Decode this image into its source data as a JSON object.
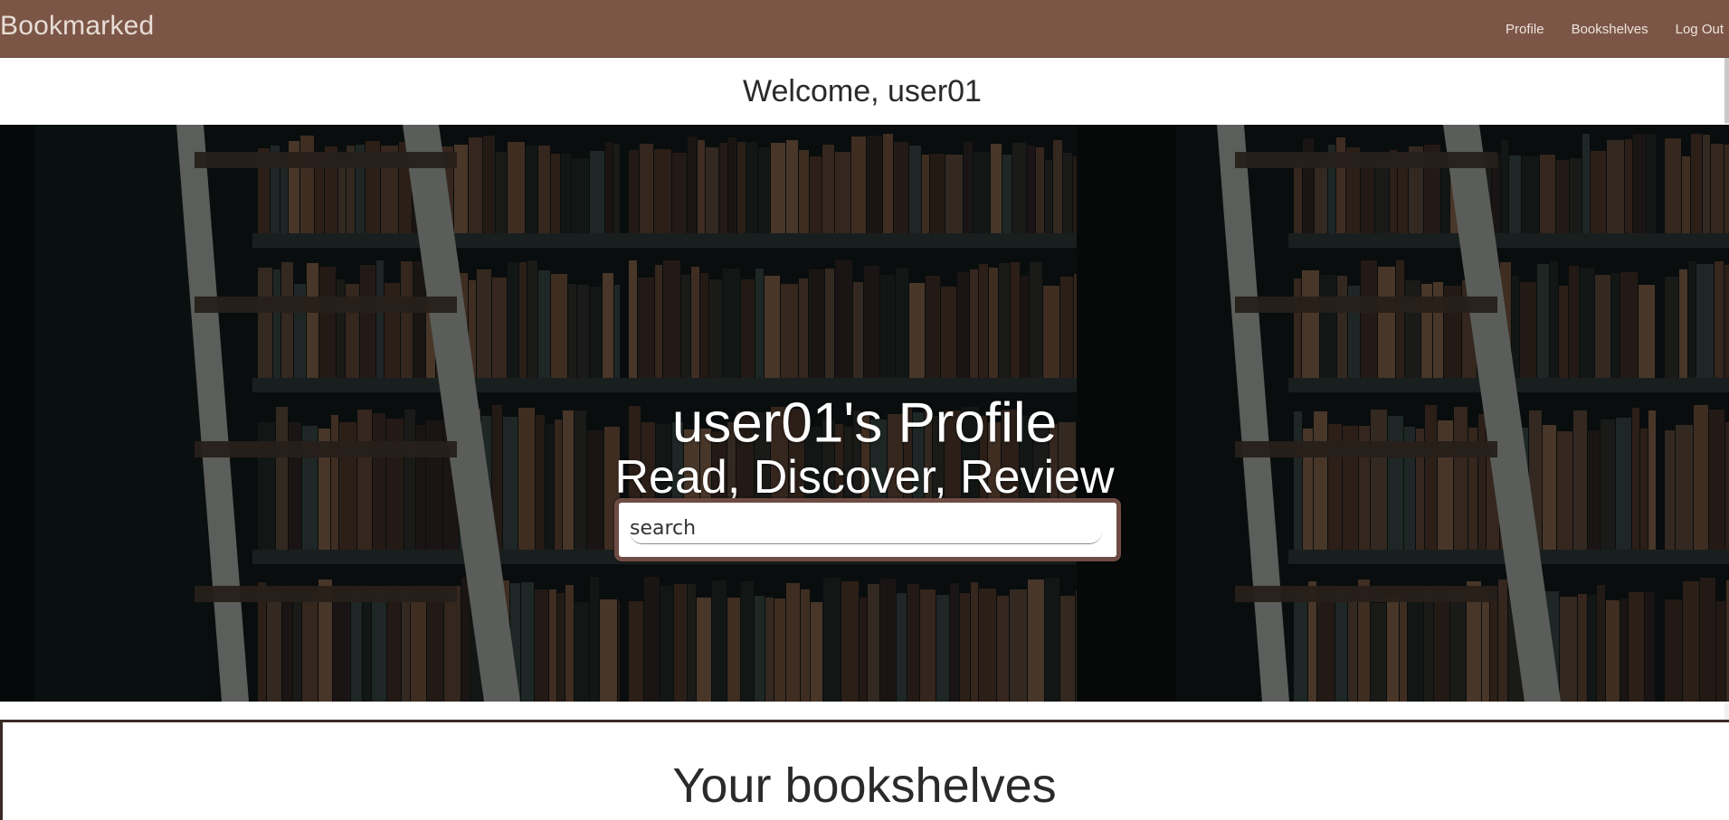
{
  "navbar": {
    "brand": "Bookmarked",
    "links": [
      "Profile",
      "Bookshelves",
      "Log Out"
    ]
  },
  "welcome": "Welcome, user01",
  "hero": {
    "title": "user01's Profile",
    "subtitle": "Read, Discover, Review",
    "search_placeholder": "search",
    "search_value": ""
  },
  "bookshelves_section": {
    "title": "Your bookshelves"
  },
  "colors": {
    "navbar": "#7b5646",
    "search_border": "#6e4c44",
    "panel_border": "#3a2a26"
  }
}
